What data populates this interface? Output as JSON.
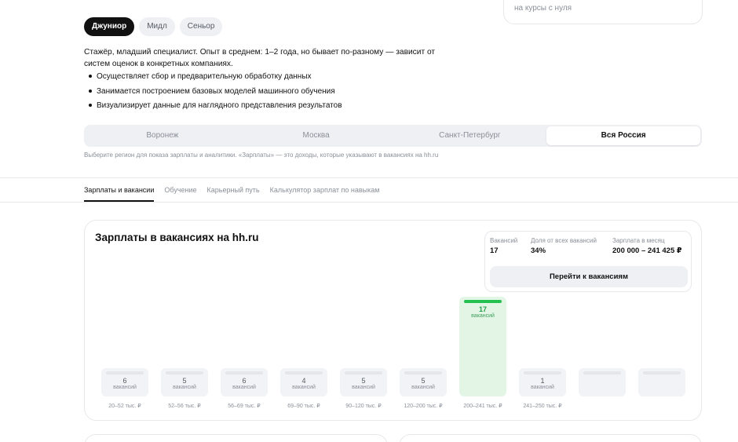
{
  "top_card": {
    "text": "на курсы с нуля"
  },
  "levels": [
    {
      "label": "Джуниор",
      "active": true
    },
    {
      "label": "Мидл",
      "active": false
    },
    {
      "label": "Сеньор",
      "active": false
    }
  ],
  "description": "Стажёр, младший специалист. Опыт в среднем: 1–2 года, но бывает по-разному — зависит от систем оценок в конкретных компаниях.",
  "bullets": [
    "Осуществляет сбор и предварительную обработку данных",
    "Занимается построением базовых моделей машинного обучения",
    "Визуализирует данные для наглядного представления результатов"
  ],
  "regions": [
    {
      "label": "Воронеж",
      "active": false
    },
    {
      "label": "Москва",
      "active": false
    },
    {
      "label": "Санкт-Петербург",
      "active": false
    },
    {
      "label": "Вся Россия",
      "active": true
    }
  ],
  "region_note": "Выберите регион для показа зарплаты и аналитики. «Зарплаты» — это доходы, которые указывают в вакансиях на hh.ru",
  "tabs": [
    {
      "label": "Зарплаты и вакансии",
      "active": true
    },
    {
      "label": "Обучение",
      "active": false
    },
    {
      "label": "Карьерный путь",
      "active": false
    },
    {
      "label": "Калькулятор зарплат по навыкам",
      "active": false
    }
  ],
  "panel": {
    "title": "Зарплаты в вакансиях на hh.ru",
    "stats": {
      "vacancies_label": "Вакансий",
      "vacancies_value": "17",
      "share_label": "Доля от всех вакансий",
      "share_value": "34%",
      "salary_label": "Зарплата в месяц",
      "salary_value": "200 000 – 241 425 ₽",
      "button_label": "Перейти к вакансиям"
    }
  },
  "chart_data": {
    "type": "bar",
    "categories": [
      "20–52 тыс. ₽",
      "52–56 тыс. ₽",
      "56–69 тыс. ₽",
      "69–90 тыс. ₽",
      "90–120 тыс. ₽",
      "120–200 тыс. ₽",
      "200–241 тыс. ₽",
      "241–250 тыс. ₽",
      "",
      ""
    ],
    "values": [
      6,
      5,
      6,
      4,
      5,
      5,
      17,
      1,
      null,
      null
    ],
    "unit_label": "вакансий",
    "highlighted_index": 6,
    "colors": {
      "bar": "#f1f3f6",
      "highlight": "#e3f6e6",
      "highlight_cap": "#23c14f"
    }
  }
}
